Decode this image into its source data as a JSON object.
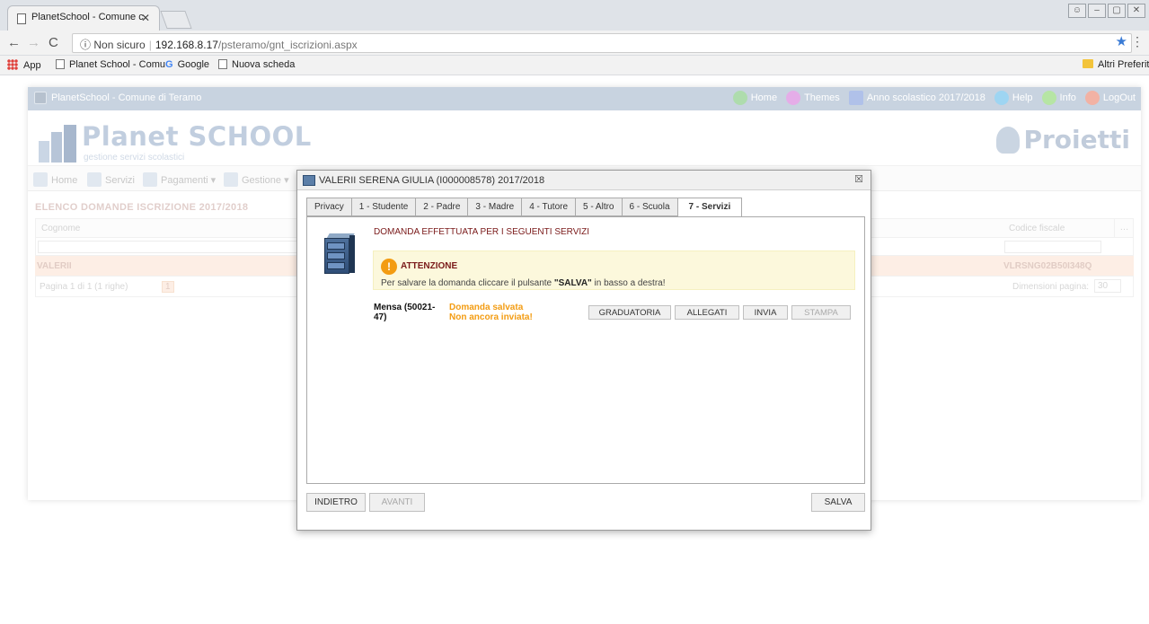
{
  "browser": {
    "tab_title": "PlanetSchool - Comune c",
    "tab_close": "✕",
    "security": "Non sicuro",
    "url_host": "192.168.8.17",
    "url_path": "/psteramo/gnt_iscrizioni.aspx",
    "bookmarks": [
      "App",
      "Planet School - Comu",
      "Google",
      "Nuova scheda"
    ],
    "other_bookmarks": "Altri Preferiti"
  },
  "app": {
    "header_title": "PlanetSchool - Comune di Teramo",
    "topnav": [
      {
        "label": "Home",
        "color": "#6cc06a"
      },
      {
        "label": "Themes",
        "color": "#d06ad6"
      },
      {
        "label": "Anno scolastico 2017/2018",
        "color": "#6f8fd8"
      },
      {
        "label": "Help",
        "color": "#4fb3e8"
      },
      {
        "label": "Info",
        "color": "#7bcf5a"
      },
      {
        "label": "LogOut",
        "color": "#e8735a"
      }
    ],
    "brand_title": "Planet SCHOOL",
    "brand_subtitle": "gestione servizi scolastici",
    "brand_right": "Proietti",
    "menu": [
      "Home",
      "Servizi",
      "Pagamenti",
      "Gestione"
    ],
    "section_title": "ELENCO DOMANDE ISCRIZIONE 2017/2018",
    "grid": {
      "col_cognome": "Cognome",
      "col_codice_fiscale": "Codice fiscale",
      "row_cognome": "VALERII",
      "row_codice_fiscale": "VLRSNG02B50I348Q",
      "pager_text": "Pagina 1 di 1 (1 righe)",
      "pager_current": "1",
      "page_size_label": "Dimensioni pagina:",
      "page_size": "30"
    }
  },
  "modal": {
    "title": "VALERII SERENA GIULIA (I000008578) 2017/2018",
    "close": "☒",
    "tabs": [
      "Privacy",
      "1 - Studente",
      "2 - Padre",
      "3 - Madre",
      "4 - Tutore",
      "5 - Altro",
      "6 - Scuola",
      "7 - Servizi"
    ],
    "active_tab": "7 - Servizi",
    "heading": "DOMANDA EFFETTUATA PER I SEGUENTI SERVIZI",
    "warning_title": "ATTENZIONE",
    "warning_pre": "Per salvare la domanda cliccare il pulsante ",
    "warning_bold": "\"SALVA\"",
    "warning_post": " in basso a destra!",
    "service_name": "Mensa (50021-47)",
    "status_line1": "Domanda salvata",
    "status_line2": "Non ancora inviata!",
    "service_buttons": [
      "GRADUATORIA",
      "ALLEGATI",
      "INVIA",
      "STAMPA"
    ],
    "btn_back": "INDIETRO",
    "btn_next": "AVANTI",
    "btn_save": "SALVA"
  }
}
